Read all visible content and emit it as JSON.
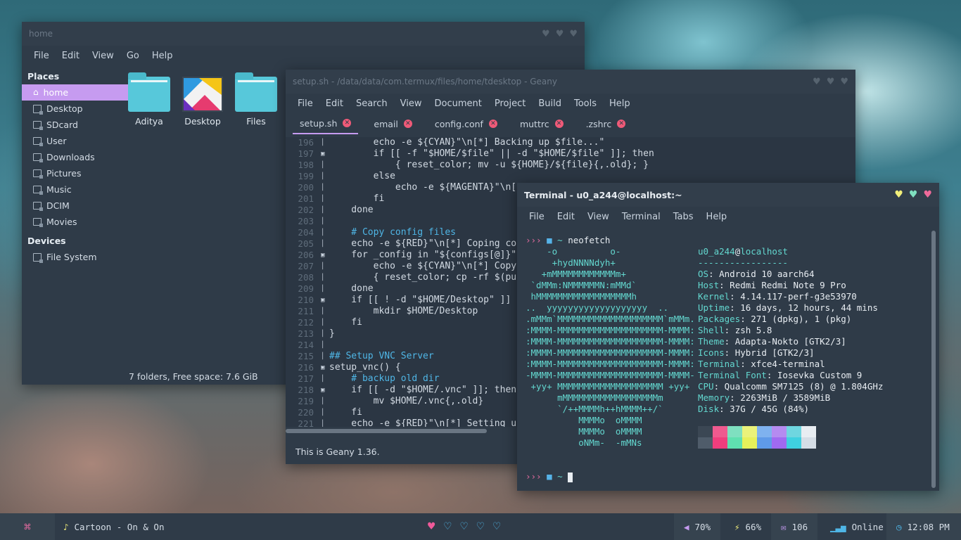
{
  "file_manager": {
    "title": "home",
    "menu": [
      "File",
      "Edit",
      "View",
      "Go",
      "Help"
    ],
    "places_header": "Places",
    "places": [
      "home",
      "Desktop",
      "SDcard",
      "User",
      "Downloads",
      "Pictures",
      "Music",
      "DCIM",
      "Movies"
    ],
    "devices_header": "Devices",
    "devices": [
      "File System"
    ],
    "items": [
      "Aditya",
      "Desktop",
      "Files"
    ],
    "status": "7 folders, Free space: 7.6 GiB"
  },
  "geany": {
    "title": "setup.sh - /data/data/com.termux/files/home/tdesktop - Geany",
    "menu": [
      "File",
      "Edit",
      "Search",
      "View",
      "Document",
      "Project",
      "Build",
      "Tools",
      "Help"
    ],
    "tabs": [
      "setup.sh",
      "email",
      "config.conf",
      "muttrc",
      ".zshrc"
    ],
    "line_numbers": [
      "196",
      "197",
      "198",
      "199",
      "200",
      "201",
      "202",
      "203",
      "204",
      "205",
      "206",
      "207",
      "208",
      "209",
      "210",
      "211",
      "212",
      "213",
      "214",
      "215",
      "216",
      "217",
      "218",
      "219",
      "220",
      "221"
    ],
    "code": [
      "        echo -e ${CYAN}\"\\n[*] Backing up $file...\"",
      "        if [[ -f \"$HOME/$file\" || -d \"$HOME/$file\" ]]; then",
      "            { reset_color; mv -u ${HOME}/${file}{,.old}; }",
      "        else",
      "            echo -e ${MAGENTA}\"\\n[",
      "        fi",
      "    done",
      "",
      "    # Copy config files",
      "    echo -e ${RED}\"\\n[*] Coping co",
      "    for _config in \"${configs[@]}\"",
      "        echo -e ${CYAN}\"\\n[*] Copy",
      "        { reset_color; cp -rf $(pu",
      "    done",
      "    if [[ ! -d \"$HOME/Desktop\" ]]",
      "        mkdir $HOME/Desktop",
      "    fi",
      "}",
      "",
      "## Setup VNC Server",
      "setup_vnc() {",
      "    # backup old dir",
      "    if [[ -d \"$HOME/.vnc\" ]]; then",
      "        mv $HOME/.vnc{,.old}",
      "    fi",
      "    echo -e ${RED}\"\\n[*] Setting u"
    ],
    "status": "This is Geany 1.36."
  },
  "terminal": {
    "title": "Terminal - u0_a244@localhost:~",
    "menu": [
      "File",
      "Edit",
      "View",
      "Terminal",
      "Tabs",
      "Help"
    ],
    "prompt_arrow": "›››",
    "prompt_dir": "~",
    "command": "neofetch",
    "logo": [
      "    -o          o-",
      "     +hydNNNNdyh+",
      "   +mMMMMMMMMMMMMm+",
      " `dMMm:NMMMMMMN:mMMd`",
      " hMMMMMMMMMMMMMMMMMMh",
      "..  yyyyyyyyyyyyyyyyyyy  ..",
      ".mMMm`MMMMMMMMMMMMMMMMMMMM`mMMm.",
      ":MMMM-MMMMMMMMMMMMMMMMMMMM-MMMM:",
      ":MMMM-MMMMMMMMMMMMMMMMMMMM-MMMM:",
      ":MMMM-MMMMMMMMMMMMMMMMMMMM-MMMM:",
      ":MMMM-MMMMMMMMMMMMMMMMMMMM-MMMM:",
      "-MMMM-MMMMMMMMMMMMMMMMMMMM-MMMM-",
      " +yy+ MMMMMMMMMMMMMMMMMMMM +yy+",
      "      mMMMMMMMMMMMMMMMMMMm",
      "      `/++MMMMh++hMMMM++/`",
      "          MMMMo  oMMMM",
      "          MMMMo  oMMMM",
      "          oNMm-  -mMNs"
    ],
    "user": "u0_a244",
    "at": "@",
    "host": "localhost",
    "separator": "-----------------",
    "info": [
      {
        "k": "OS",
        "v": "Android 10 aarch64"
      },
      {
        "k": "Host",
        "v": "Redmi Redmi Note 9 Pro"
      },
      {
        "k": "Kernel",
        "v": "4.14.117-perf-g3e53970"
      },
      {
        "k": "Uptime",
        "v": "16 days, 12 hours, 44 mins"
      },
      {
        "k": "Packages",
        "v": "271 (dpkg), 1 (pkg)"
      },
      {
        "k": "Shell",
        "v": "zsh 5.8"
      },
      {
        "k": "Theme",
        "v": "Adapta-Nokto [GTK2/3]"
      },
      {
        "k": "Icons",
        "v": "Hybrid [GTK2/3]"
      },
      {
        "k": "Terminal",
        "v": "xfce4-terminal"
      },
      {
        "k": "Terminal Font",
        "v": "Iosevka Custom 9"
      },
      {
        "k": "CPU",
        "v": "Qualcomm SM7125 (8) @ 1.804GHz"
      },
      {
        "k": "Memory",
        "v": "2263MiB / 3589MiB"
      },
      {
        "k": "Disk",
        "v": "37G / 45G (84%)"
      }
    ],
    "palette_top": [
      "#3b4754",
      "#ef5a8f",
      "#7fe0c0",
      "#eaf27a",
      "#7fb2ef",
      "#b58bf0",
      "#6fd6e0",
      "#e8edf2"
    ],
    "palette_bottom": [
      "#4f5c6a",
      "#ef3e7d",
      "#5fe0b0",
      "#e6f05a",
      "#5f9ae8",
      "#a06af0",
      "#3fd0e0",
      "#d5dde6"
    ],
    "colon": ":"
  },
  "panel": {
    "launcher_icon": "command-icon",
    "music": "Cartoon - On & On",
    "workspaces": 5,
    "volume": "70%",
    "battery": "66%",
    "mail": "106",
    "network": "Online",
    "time": "12:08 PM"
  }
}
